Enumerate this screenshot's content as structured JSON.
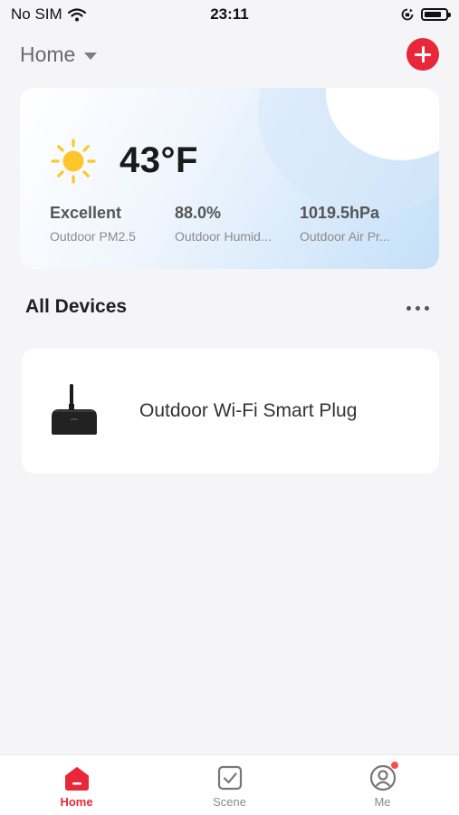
{
  "status_bar": {
    "carrier": "No SIM",
    "time": "23:11",
    "battery_level": 0.8
  },
  "header": {
    "home_label": "Home"
  },
  "weather": {
    "temperature": "43°F",
    "stats": [
      {
        "value": "Excellent",
        "label": "Outdoor PM2.5"
      },
      {
        "value": "88.0%",
        "label": "Outdoor Humid..."
      },
      {
        "value": "1019.5hPa",
        "label": "Outdoor Air Pr..."
      }
    ]
  },
  "devices_section": {
    "title": "All Devices"
  },
  "devices": [
    {
      "name": "Outdoor Wi-Fi Smart Plug"
    }
  ],
  "tab_bar": {
    "tabs": [
      {
        "label": "Home",
        "icon": "home-icon",
        "active": true
      },
      {
        "label": "Scene",
        "icon": "checkbox-icon",
        "active": false
      },
      {
        "label": "Me",
        "icon": "user-icon",
        "active": false,
        "badge": true
      }
    ]
  },
  "colors": {
    "accent": "#e8283a",
    "sun": "#ffc62b",
    "background": "#f5f5f7"
  }
}
